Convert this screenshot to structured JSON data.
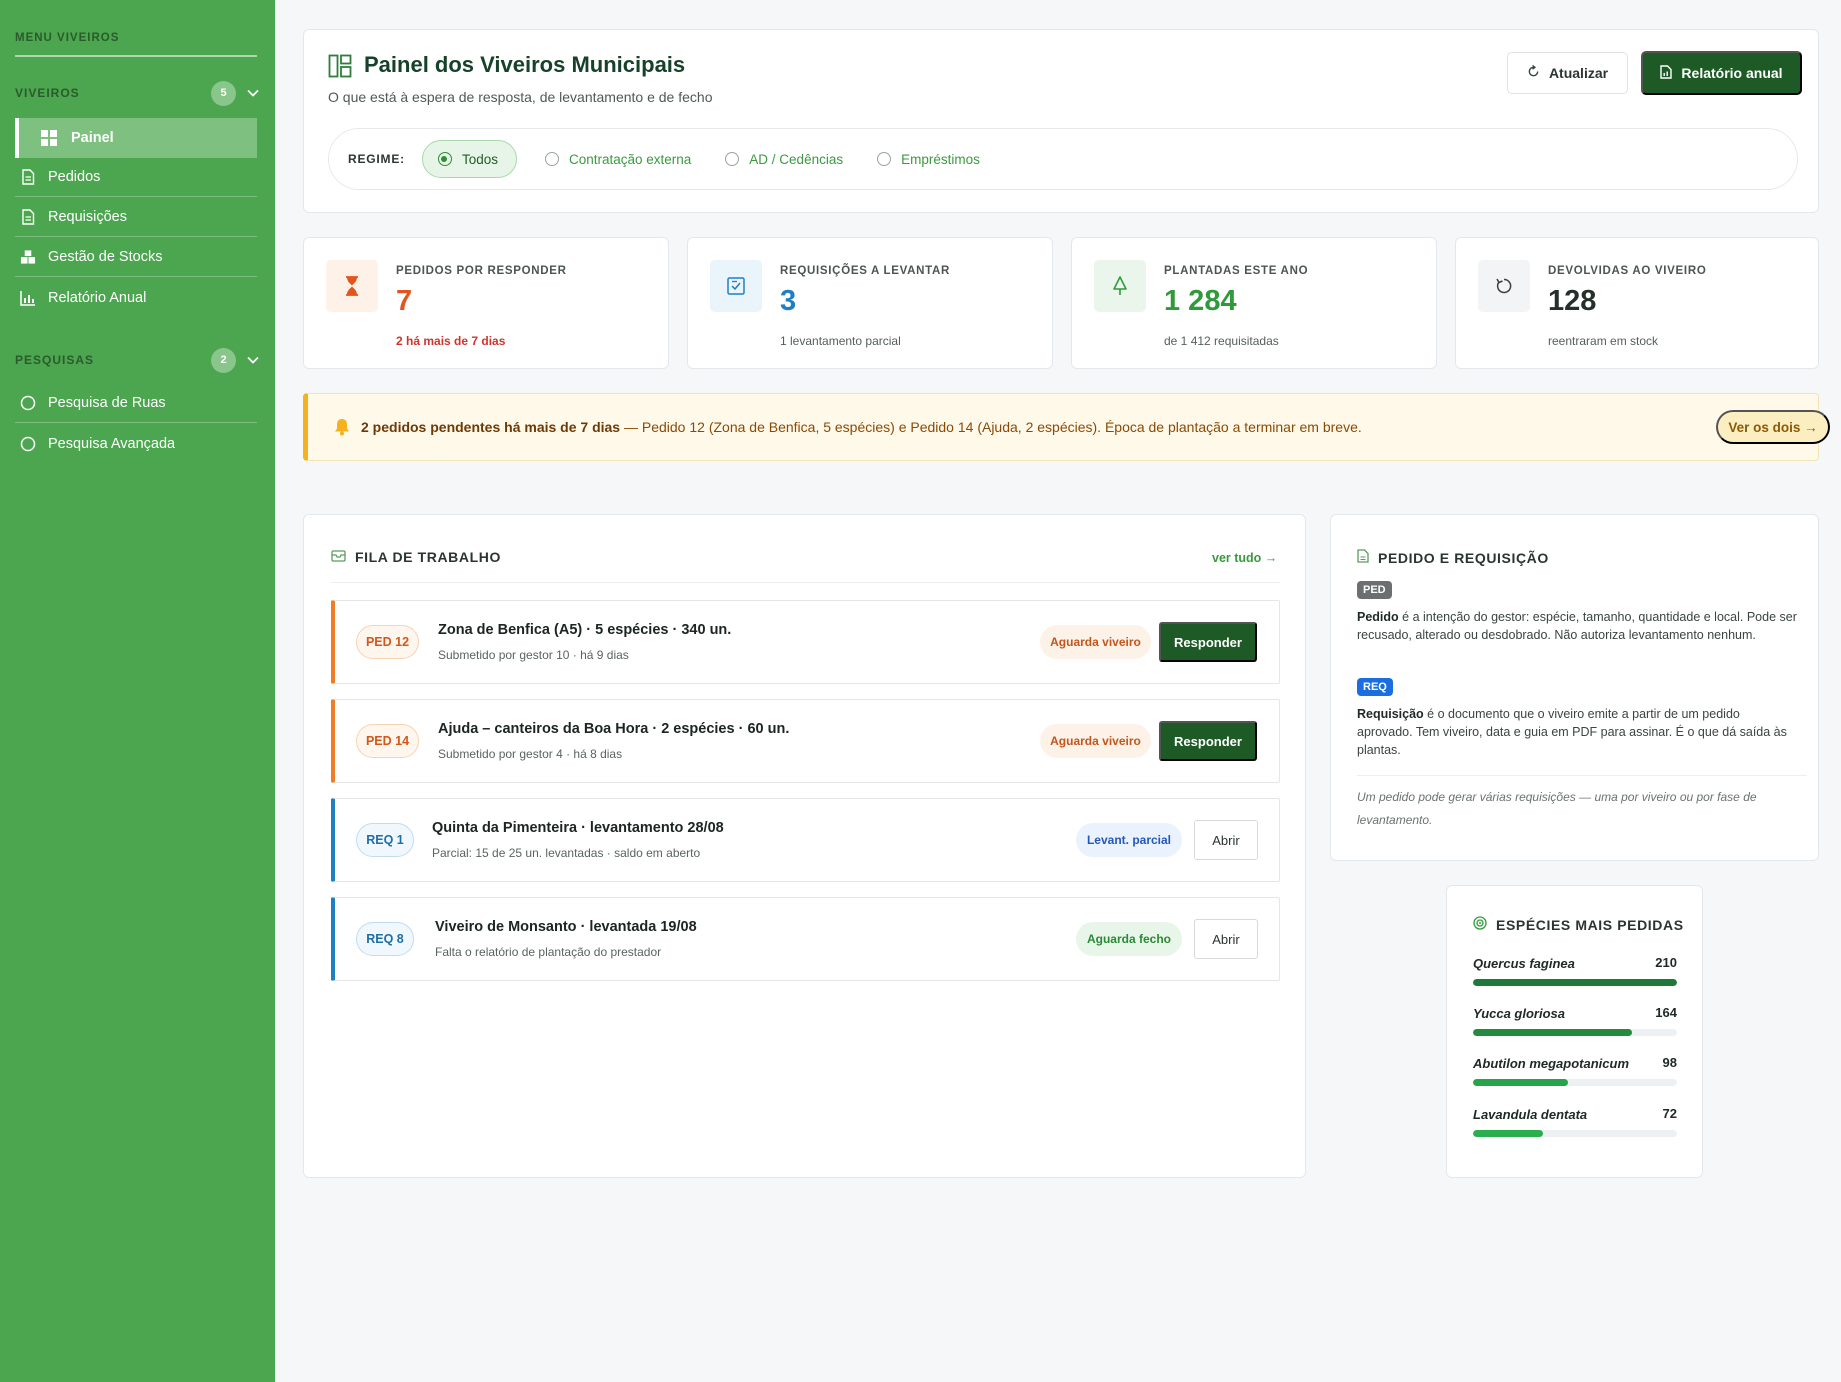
{
  "sidebar": {
    "menu_title": "MENU VIVEIROS",
    "groups": [
      {
        "label": "VIVEIROS",
        "count": "5",
        "items": [
          {
            "label": "Painel",
            "icon": "grid-icon",
            "active": true
          },
          {
            "label": "Pedidos",
            "icon": "document-icon"
          },
          {
            "label": "Requisições",
            "icon": "document-icon"
          },
          {
            "label": "Gestão de Stocks",
            "icon": "boxes-icon"
          },
          {
            "label": "Relatório Anual",
            "icon": "bar-chart-icon"
          }
        ]
      },
      {
        "label": "PESQUISAS",
        "count": "2",
        "items": [
          {
            "label": "Pesquisa de Ruas",
            "icon": "circle-icon"
          },
          {
            "label": "Pesquisa Avançada",
            "icon": "circle-icon"
          }
        ]
      }
    ]
  },
  "header": {
    "title": "Painel dos Viveiros Municipais",
    "subtitle": "O que está à espera de resposta, de levantamento e de fecho",
    "refresh_label": "Atualizar",
    "report_label": "Relatório anual"
  },
  "regime": {
    "label": "REGIME:",
    "options": [
      "Todos",
      "Contratação externa",
      "AD / Cedências",
      "Empréstimos"
    ],
    "selected": "Todos"
  },
  "stats": [
    {
      "label": "PEDIDOS POR RESPONDER",
      "value": "7",
      "note": "2 há mais de 7 dias",
      "value_color": "#e0561e",
      "note_color": "#d0342c",
      "icon_bg": "#fdf1e8",
      "icon": "hourglass-icon"
    },
    {
      "label": "REQUISIÇÕES A LEVANTAR",
      "value": "3",
      "note": "1 levantamento parcial",
      "value_color": "#1f7fc0",
      "note_color": "#56605a",
      "icon_bg": "#eaf4fb",
      "icon": "checklist-icon"
    },
    {
      "label": "PLANTADAS ESTE ANO",
      "value": "1 284",
      "note": "de 1 412 requisitadas",
      "value_color": "#2f9a3a",
      "note_color": "#56605a",
      "icon_bg": "#eaf6ec",
      "icon": "tree-icon"
    },
    {
      "label": "DEVOLVIDAS AO VIVEIRO",
      "value": "128",
      "note": "reentraram em stock",
      "value_color": "#24302a",
      "note_color": "#56605a",
      "icon_bg": "#f2f4f5",
      "icon": "undo-icon"
    }
  ],
  "alert": {
    "strong": "2 pedidos pendentes há mais de 7 dias",
    "text": " — Pedido 12 (Zona de Benfica, 5 espécies) e Pedido 14 (Ajuda, 2 espécies). Época de plantação a terminar em breve.",
    "action": "Ver os dois →"
  },
  "queue": {
    "title": "FILA DE TRABALHO",
    "see_all": "ver tudo →",
    "rows": [
      {
        "tag": "PED 12",
        "kind": "ped",
        "title": "Zona de Benfica (A5) · 5 espécies · 340 un.",
        "sub": "Submetido por gestor 10 · há 9 dias",
        "status": "Aguarda viveiro",
        "action": "Responder"
      },
      {
        "tag": "PED 14",
        "kind": "ped",
        "title": "Ajuda – canteiros da Boa Hora · 2 espécies · 60 un.",
        "sub": "Submetido por gestor 4 · há 8 dias",
        "status": "Aguarda viveiro",
        "action": "Responder"
      },
      {
        "tag": "REQ 1",
        "kind": "req",
        "title": "Quinta da Pimenteira · levantamento 28/08",
        "sub": "Parcial: 15 de 25 un. levantadas · saldo em aberto",
        "status": "Levant. parcial",
        "action": "Abrir"
      },
      {
        "tag": "REQ 8",
        "kind": "req",
        "title": "Viveiro de Monsanto · levantada 19/08",
        "sub": "Falta o relatório de plantação do prestador",
        "status": "Aguarda fecho",
        "action": "Abrir"
      }
    ]
  },
  "definitions": {
    "title": "PEDIDO E REQUISIÇÃO",
    "ped_badge": "PED",
    "ped_term": "Pedido",
    "ped_text": " é a intenção do gestor: espécie, tamanho, quantidade e local. Pode ser recusado, alterado ou desdobrado. Não autoriza levantamento nenhum.",
    "req_badge": "REQ",
    "req_term": "Requisição",
    "req_text": " é o documento que o viveiro emite a partir de um pedido aprovado. Tem viveiro, data e guia em PDF para assinar. É o que dá saída às plantas.",
    "note": "Um pedido pode gerar várias requisições — uma por viveiro ou por fase de levantamento."
  },
  "species": {
    "title": "ESPÉCIES MAIS PEDIDAS",
    "max": 210,
    "items": [
      {
        "name": "Quercus faginea",
        "value": "210",
        "fill": 1.0,
        "color": "#1f7a3a"
      },
      {
        "name": "Yucca gloriosa",
        "value": "164",
        "fill": 0.78,
        "color": "#238a40"
      },
      {
        "name": "Abutilon megapotanicum",
        "value": "98",
        "fill": 0.467,
        "color": "#27a34a"
      },
      {
        "name": "Lavandula dentata",
        "value": "72",
        "fill": 0.343,
        "color": "#2aae4f"
      }
    ]
  },
  "colors": {
    "sidebar": "#4ca64f",
    "primary_dark": "#1e5a26",
    "accent_green": "#3b9a3f",
    "ped_orange": "#f07d25",
    "req_blue": "#1e7fc2"
  }
}
